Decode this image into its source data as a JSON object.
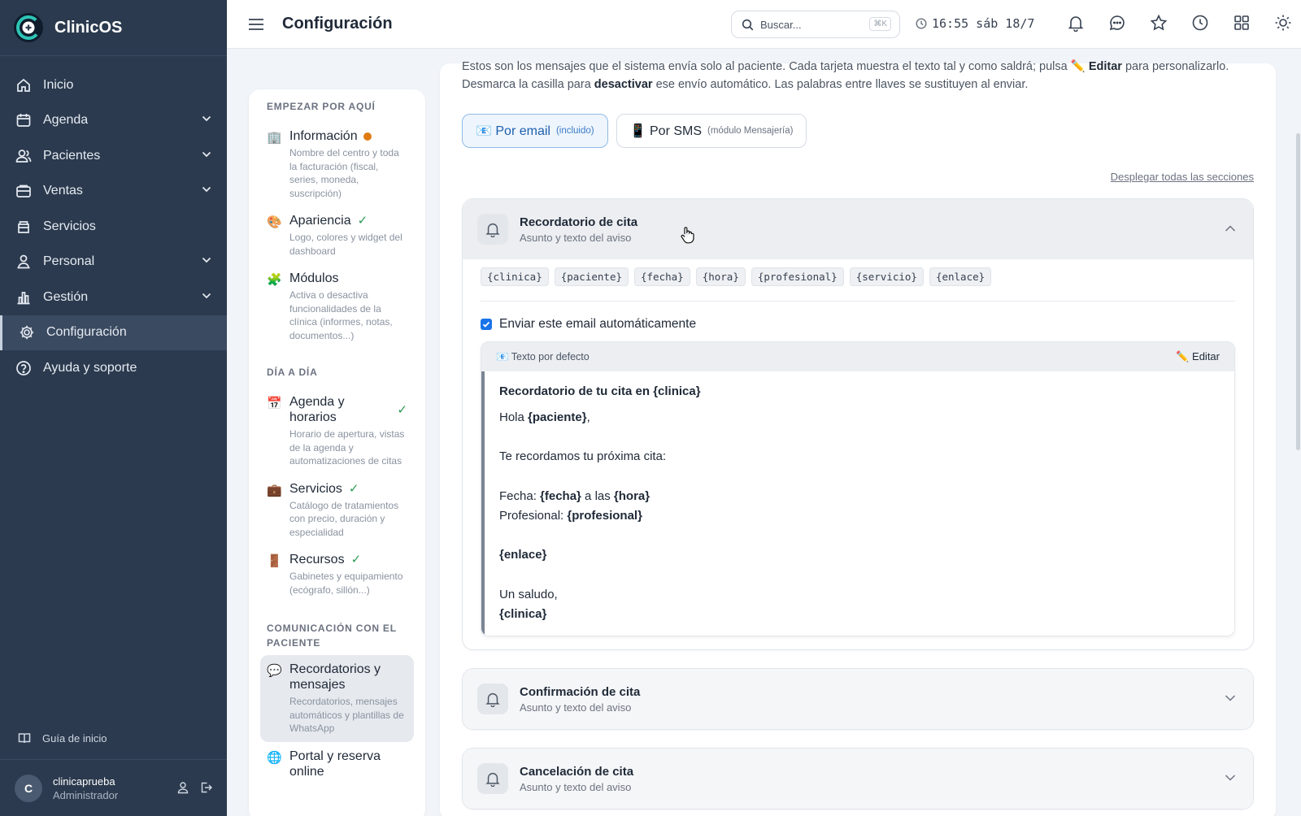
{
  "brand": {
    "name": "ClinicOS"
  },
  "sidebar": {
    "items": [
      {
        "label": "Inicio",
        "icon": "home-icon",
        "has_chevron": false
      },
      {
        "label": "Agenda",
        "icon": "calendar-icon",
        "has_chevron": true
      },
      {
        "label": "Pacientes",
        "icon": "users-icon",
        "has_chevron": true
      },
      {
        "label": "Ventas",
        "icon": "wallet-icon",
        "has_chevron": true
      },
      {
        "label": "Servicios",
        "icon": "box-icon",
        "has_chevron": false
      },
      {
        "label": "Personal",
        "icon": "staff-icon",
        "has_chevron": true
      },
      {
        "label": "Gestión",
        "icon": "chart-icon",
        "has_chevron": true
      },
      {
        "label": "Configuración",
        "icon": "gear-icon",
        "has_chevron": false,
        "active": true
      },
      {
        "label": "Ayuda y soporte",
        "icon": "help-icon",
        "has_chevron": false
      }
    ],
    "guide_label": "Guía de inicio",
    "user": {
      "initial": "C",
      "name": "clinicaprueba",
      "role": "Administrador"
    }
  },
  "topbar": {
    "title": "Configuración",
    "search_placeholder": "Buscar...",
    "search_shortcut": "⌘K",
    "clock": "16:55 sáb 18/7"
  },
  "subnav": {
    "sections": [
      {
        "heading": "EMPEZAR POR AQUÍ",
        "items": [
          {
            "emoji": "🏢",
            "title": "Información",
            "status": "dot",
            "desc": "Nombre del centro y toda la facturación (fiscal, series, moneda, suscripción)"
          },
          {
            "emoji": "🎨",
            "title": "Apariencia",
            "status": "check",
            "desc": "Logo, colores y widget del dashboard"
          },
          {
            "emoji": "🧩",
            "title": "Módulos",
            "status": "",
            "desc": "Activa o desactiva funcionalidades de la clínica (informes, notas, documentos...)"
          }
        ]
      },
      {
        "heading": "DÍA A DÍA",
        "items": [
          {
            "emoji": "📅",
            "title": "Agenda y horarios",
            "status": "check",
            "desc": "Horario de apertura, vistas de la agenda y automatizaciones de citas"
          },
          {
            "emoji": "💼",
            "title": "Servicios",
            "status": "check",
            "desc": "Catálogo de tratamientos con precio, duración y especialidad"
          },
          {
            "emoji": "🚪",
            "title": "Recursos",
            "status": "check",
            "desc": "Gabinetes y equipamiento (ecógrafo, sillón...)"
          }
        ]
      },
      {
        "heading": "COMUNICACIÓN CON EL PACIENTE",
        "items": [
          {
            "emoji": "💬",
            "title": "Recordatorios y mensajes",
            "status": "",
            "desc": "Recordatorios, mensajes automáticos y plantillas de WhatsApp",
            "active": true
          },
          {
            "emoji": "🌐",
            "title": "Portal y reserva online",
            "status": "",
            "desc": ""
          }
        ]
      }
    ]
  },
  "main": {
    "intro": {
      "p1": "Estos son los mensajes que el sistema envía solo al paciente. Cada tarjeta muestra el texto tal y como saldrá; pulsa ",
      "edit_word": "✏️ Editar",
      "p2": " para personalizarlo. Desmarca la casilla para ",
      "disable_word": "desactivar",
      "p3": " ese envío automático. Las palabras entre llaves se sustituyen al enviar."
    },
    "channels": [
      {
        "label": "📧 Por email",
        "note": "(incluido)",
        "active": true
      },
      {
        "label": "📱 Por SMS",
        "note": "(módulo Mensajería)",
        "active": false
      }
    ],
    "expand_all": "Desplegar todas las secciones",
    "cards": [
      {
        "title": "Recordatorio de cita",
        "subtitle": "Asunto y texto del aviso",
        "open": true,
        "variables": [
          "{clinica}",
          "{paciente}",
          "{fecha}",
          "{hora}",
          "{profesional}",
          "{servicio}",
          "{enlace}"
        ],
        "auto_label": "Enviar este email automáticamente",
        "auto_checked": true,
        "template_label": "📧 Texto por defecto",
        "edit_label": "✏️ Editar",
        "subject": "Recordatorio de tu cita en {clinica}",
        "body": [
          {
            "parts": [
              [
                "Hola ",
                false
              ],
              [
                "{paciente}",
                true
              ],
              [
                ",",
                false
              ]
            ]
          },
          {
            "parts": []
          },
          {
            "parts": [
              [
                "Te recordamos tu próxima cita:",
                false
              ]
            ]
          },
          {
            "parts": []
          },
          {
            "parts": [
              [
                "Fecha: ",
                false
              ],
              [
                "{fecha}",
                true
              ],
              [
                " a las ",
                false
              ],
              [
                "{hora}",
                true
              ]
            ]
          },
          {
            "parts": [
              [
                "Profesional: ",
                false
              ],
              [
                "{profesional}",
                true
              ]
            ]
          },
          {
            "parts": []
          },
          {
            "parts": [
              [
                "{enlace}",
                true
              ]
            ]
          },
          {
            "parts": []
          },
          {
            "parts": [
              [
                "Un saludo,",
                false
              ]
            ]
          },
          {
            "parts": [
              [
                "{clinica}",
                true
              ]
            ]
          }
        ]
      },
      {
        "title": "Confirmación de cita",
        "subtitle": "Asunto y texto del aviso",
        "open": false
      },
      {
        "title": "Cancelación de cita",
        "subtitle": "Asunto y texto del aviso",
        "open": false
      }
    ]
  },
  "colors": {
    "sidebar_bg": "#2b3a4e",
    "accent": "#1a73e8",
    "status_dot": "#e07b12",
    "check": "#2e9a53"
  }
}
